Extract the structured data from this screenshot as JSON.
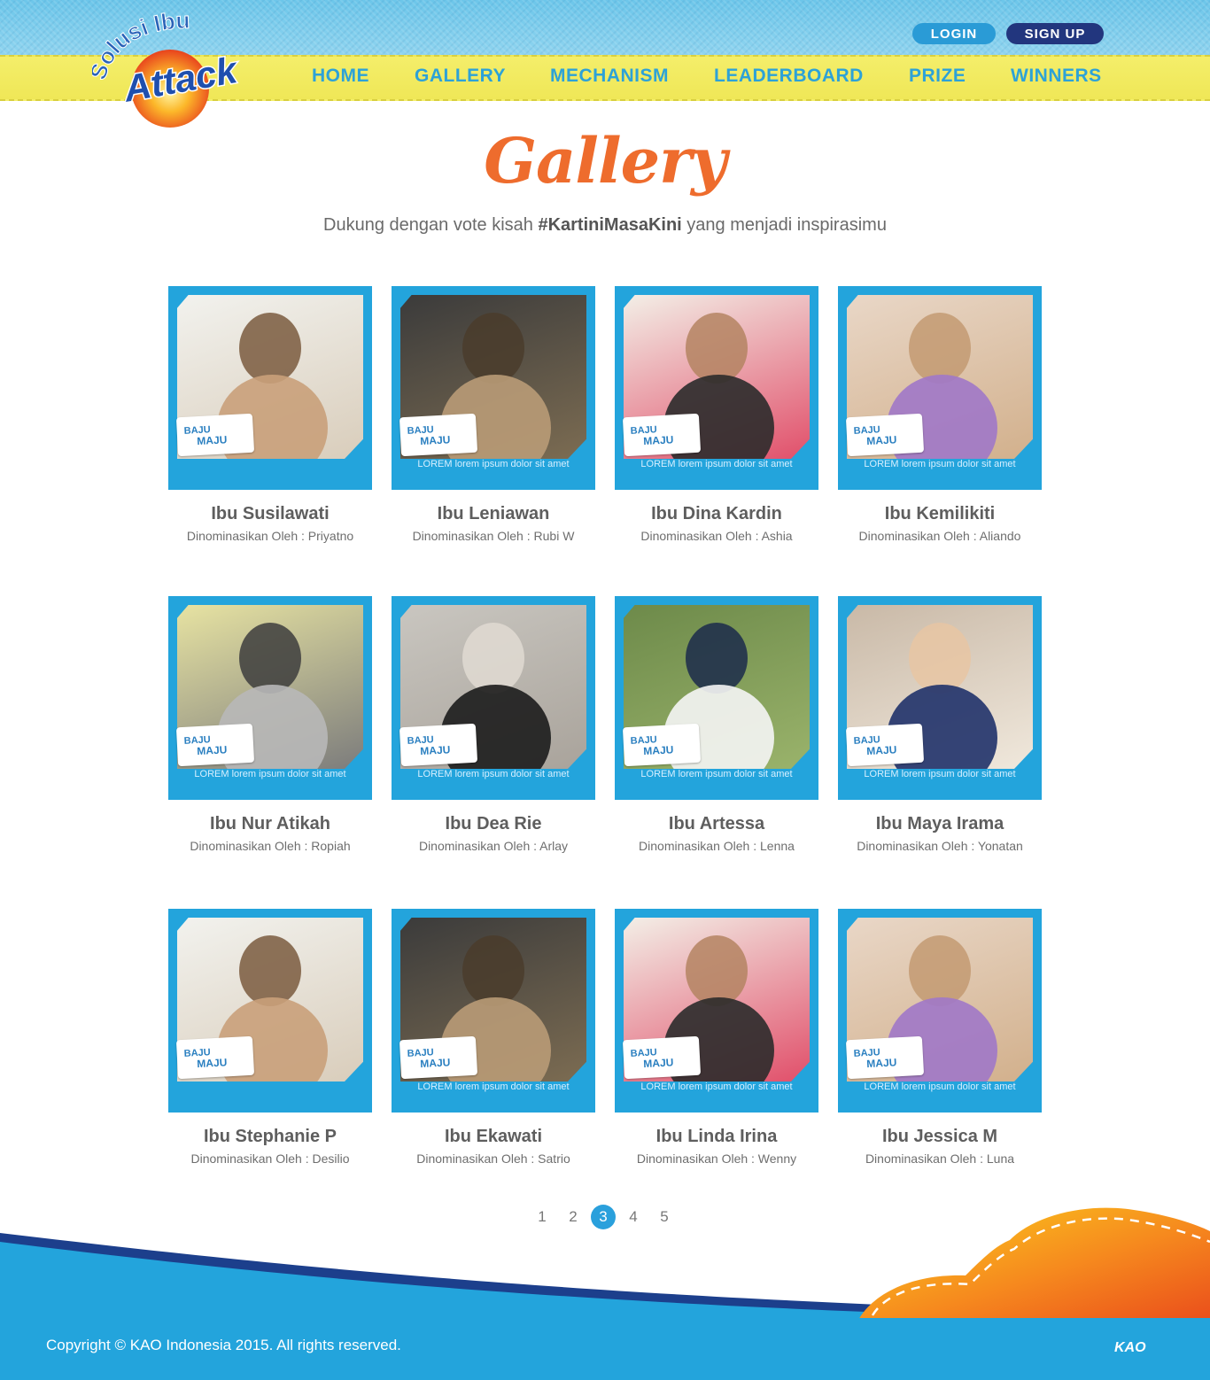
{
  "header": {
    "logo_top": "Solusi Ibu",
    "logo_brand": "Attack",
    "login": "LOGIN",
    "signup": "SIGN UP",
    "nav": [
      "HOME",
      "GALLERY",
      "MECHANISM",
      "LEADERBOARD",
      "PRIZE",
      "WINNERS"
    ]
  },
  "page": {
    "title": "Gallery",
    "subtitle_pre": "Dukung dengan vote kisah ",
    "subtitle_tag": "#KartiniMasaKini",
    "subtitle_post": " yang menjadi inspirasimu"
  },
  "card_badge": {
    "line1": "BAJU",
    "line2": "MAJU"
  },
  "cards": [
    {
      "name": "Ibu Susilawati",
      "nominator": "Dinominasikan Oleh : Priyatno",
      "caption": ""
    },
    {
      "name": "Ibu Leniawan",
      "nominator": "Dinominasikan Oleh : Rubi W",
      "caption": "LOREM lorem ipsum dolor sit amet"
    },
    {
      "name": "Ibu Dina Kardin",
      "nominator": "Dinominasikan Oleh : Ashia",
      "caption": "LOREM lorem ipsum dolor sit amet"
    },
    {
      "name": "Ibu Kemilikiti",
      "nominator": "Dinominasikan Oleh : Aliando",
      "caption": "LOREM lorem ipsum dolor sit amet"
    },
    {
      "name": "Ibu Nur Atikah",
      "nominator": "Dinominasikan Oleh : Ropiah",
      "caption": "LOREM lorem ipsum dolor sit amet"
    },
    {
      "name": "Ibu Dea Rie",
      "nominator": "Dinominasikan Oleh : Arlay",
      "caption": "LOREM lorem ipsum dolor sit amet"
    },
    {
      "name": "Ibu Artessa",
      "nominator": "Dinominasikan Oleh : Lenna",
      "caption": "LOREM lorem ipsum dolor sit amet"
    },
    {
      "name": "Ibu Maya Irama",
      "nominator": "Dinominasikan Oleh : Yonatan",
      "caption": "LOREM lorem ipsum dolor sit amet"
    },
    {
      "name": "Ibu Stephanie P",
      "nominator": "Dinominasikan Oleh : Desilio",
      "caption": ""
    },
    {
      "name": "Ibu Ekawati",
      "nominator": "Dinominasikan Oleh : Satrio",
      "caption": "LOREM lorem ipsum dolor sit amet"
    },
    {
      "name": "Ibu Linda Irina",
      "nominator": "Dinominasikan Oleh : Wenny",
      "caption": "LOREM lorem ipsum dolor sit amet"
    },
    {
      "name": "Ibu Jessica M",
      "nominator": "Dinominasikan Oleh : Luna",
      "caption": "LOREM lorem ipsum dolor sit amet"
    }
  ],
  "pagination": {
    "pages": [
      "1",
      "2",
      "3",
      "4",
      "5"
    ],
    "current": "3"
  },
  "footer": {
    "copyright": "Copyright © KAO Indonesia 2015. All rights reserved.",
    "kao_logo": "KAO"
  },
  "colors": {
    "accent_blue": "#23a4dc",
    "title_orange": "#ee6c2d",
    "nav_yellow": "#efe757",
    "dark_navy": "#22367e"
  }
}
